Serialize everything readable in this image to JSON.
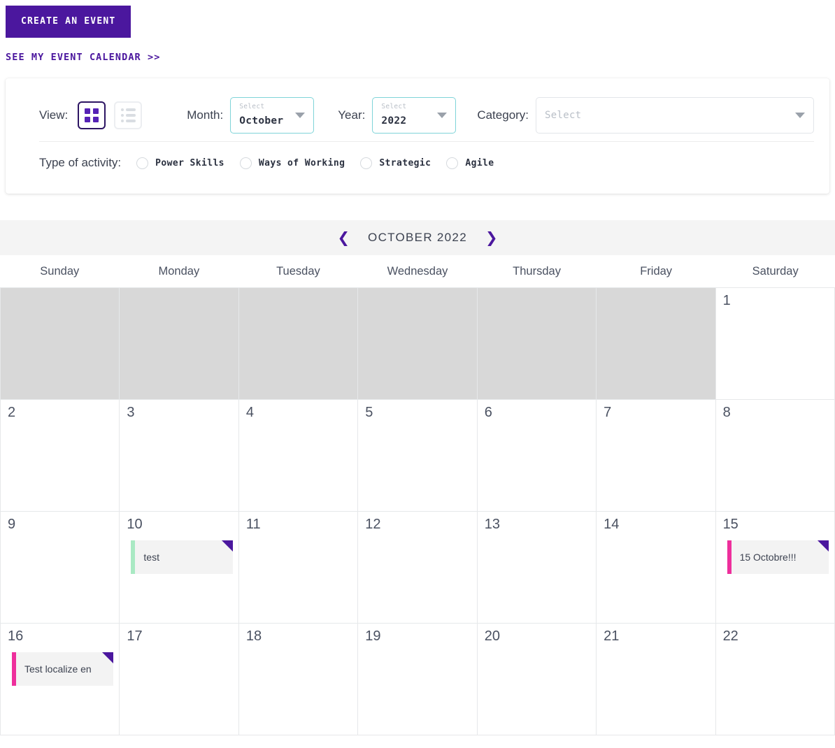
{
  "top": {
    "create_label": "CREATE AN EVENT",
    "see_calendar_label": "SEE MY EVENT CALENDAR >>"
  },
  "filters": {
    "view_label": "View:",
    "view_grid_icon": "grid-view-icon",
    "view_list_icon": "list-view-icon",
    "month_label": "Month:",
    "month_float": "Select",
    "month_value": "October",
    "year_label": "Year:",
    "year_float": "Select",
    "year_value": "2022",
    "category_label": "Category:",
    "category_placeholder": "Select",
    "activity_label": "Type of activity:",
    "activities": [
      {
        "label": "Power Skills",
        "selected": false
      },
      {
        "label": "Ways of Working",
        "selected": false
      },
      {
        "label": "Strategic",
        "selected": false
      },
      {
        "label": "Agile",
        "selected": false
      }
    ]
  },
  "calendar": {
    "title": "OCTOBER 2022",
    "prev_icon": "chevron-left-icon",
    "next_icon": "chevron-right-icon",
    "weekdays": [
      "Sunday",
      "Monday",
      "Tuesday",
      "Wednesday",
      "Thursday",
      "Friday",
      "Saturday"
    ],
    "cells": [
      {
        "day": "",
        "blank": true,
        "events": []
      },
      {
        "day": "",
        "blank": true,
        "events": []
      },
      {
        "day": "",
        "blank": true,
        "events": []
      },
      {
        "day": "",
        "blank": true,
        "events": []
      },
      {
        "day": "",
        "blank": true,
        "events": []
      },
      {
        "day": "",
        "blank": true,
        "events": []
      },
      {
        "day": "1",
        "blank": false,
        "events": []
      },
      {
        "day": "2",
        "blank": false,
        "events": []
      },
      {
        "day": "3",
        "blank": false,
        "events": []
      },
      {
        "day": "4",
        "blank": false,
        "events": []
      },
      {
        "day": "5",
        "blank": false,
        "events": []
      },
      {
        "day": "6",
        "blank": false,
        "events": []
      },
      {
        "day": "7",
        "blank": false,
        "events": []
      },
      {
        "day": "8",
        "blank": false,
        "events": []
      },
      {
        "day": "9",
        "blank": false,
        "events": []
      },
      {
        "day": "10",
        "blank": false,
        "events": [
          {
            "title": "test",
            "bar_color": "#a9e9c3",
            "flag": true
          }
        ]
      },
      {
        "day": "11",
        "blank": false,
        "events": []
      },
      {
        "day": "12",
        "blank": false,
        "events": []
      },
      {
        "day": "13",
        "blank": false,
        "events": []
      },
      {
        "day": "14",
        "blank": false,
        "events": []
      },
      {
        "day": "15",
        "blank": false,
        "events": [
          {
            "title": "15 Octobre!!!",
            "bar_color": "#ee2f9c",
            "flag": true
          }
        ]
      },
      {
        "day": "16",
        "blank": false,
        "events": [
          {
            "title": "Test localize en",
            "bar_color": "#ee2f9c",
            "flag": true
          }
        ]
      },
      {
        "day": "17",
        "blank": false,
        "events": []
      },
      {
        "day": "18",
        "blank": false,
        "events": []
      },
      {
        "day": "19",
        "blank": false,
        "events": []
      },
      {
        "day": "20",
        "blank": false,
        "events": []
      },
      {
        "day": "21",
        "blank": false,
        "events": []
      },
      {
        "day": "22",
        "blank": false,
        "events": []
      }
    ]
  },
  "colors": {
    "brand_purple": "#4B179E",
    "accent_teal": "#7fd4d8",
    "event_pink": "#ee2f9c",
    "event_green": "#a9e9c3"
  }
}
